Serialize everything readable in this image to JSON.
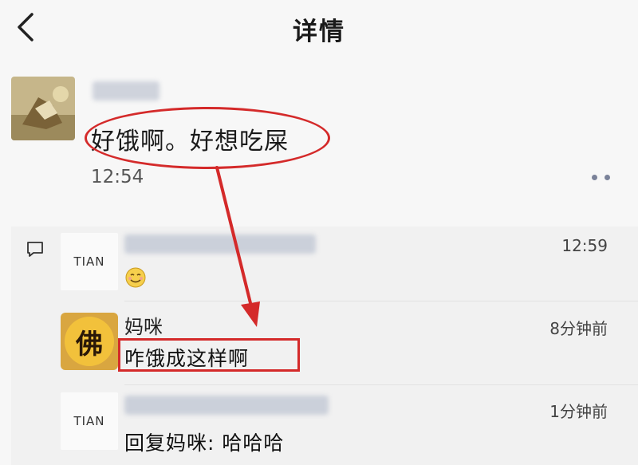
{
  "header": {
    "title": "详情"
  },
  "post": {
    "text": "好饿啊。好想吃屎",
    "time": "12:54"
  },
  "comments": [
    {
      "avatar_text": "TIAN",
      "time": "12:59"
    },
    {
      "avatar_text": "佛",
      "name": "妈咪",
      "time": "8分钟前",
      "text": "咋饿成这样啊"
    },
    {
      "avatar_text": "TIAN",
      "time": "1分钟前",
      "text": "回复妈咪: 哈哈哈"
    }
  ],
  "icons": {
    "back": "chevron-left-icon",
    "more": "more-dots-icon",
    "comment": "comment-icon",
    "emoji": "smile-emoji-icon"
  },
  "colors": {
    "annotation": "#d42a2a",
    "background": "#f7f7f7",
    "comment_background": "#f1f1f1"
  }
}
